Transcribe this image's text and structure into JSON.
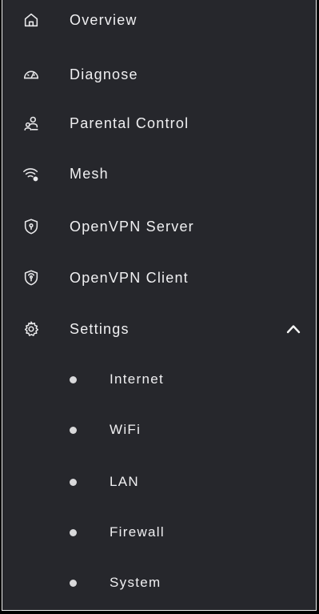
{
  "sidebar": {
    "items": [
      {
        "label": "Overview",
        "icon": "home-icon"
      },
      {
        "label": "Diagnose",
        "icon": "gauge-icon"
      },
      {
        "label": "Parental Control",
        "icon": "family-icon"
      },
      {
        "label": "Mesh",
        "icon": "mesh-wifi-icon"
      },
      {
        "label": "OpenVPN Server",
        "icon": "shield-lock-icon"
      },
      {
        "label": "OpenVPN Client",
        "icon": "shield-keyhole-icon"
      },
      {
        "label": "Settings",
        "icon": "gear-icon",
        "expanded": true
      }
    ],
    "settings_subitems": [
      {
        "label": "Internet"
      },
      {
        "label": "WiFi"
      },
      {
        "label": "LAN"
      },
      {
        "label": "Firewall"
      },
      {
        "label": "System"
      }
    ]
  },
  "colors": {
    "background": "#26272c",
    "text": "#f0f0f2",
    "border": "#f2f2f2",
    "bullet": "#d9d9db"
  }
}
